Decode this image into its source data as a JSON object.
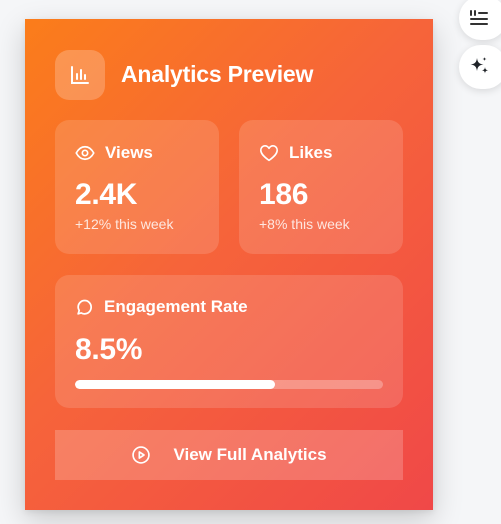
{
  "card": {
    "title": "Analytics Preview",
    "header_icon": "bar-chart-icon",
    "gradient_colors": [
      "#fb7d1a",
      "#f6643a",
      "#f04848"
    ]
  },
  "stats": {
    "views": {
      "icon": "eye-icon",
      "label": "Views",
      "value": "2.4K",
      "change": "+12% this week"
    },
    "likes": {
      "icon": "heart-icon",
      "label": "Likes",
      "value": "186",
      "change": "+8% this week"
    }
  },
  "engagement": {
    "icon": "message-circle-icon",
    "label": "Engagement Rate",
    "value": "8.5%",
    "progress_fraction": 0.65
  },
  "cta": {
    "icon": "play-circle-icon",
    "label": "View Full Analytics"
  },
  "side_buttons": [
    {
      "icon": "quote-lines-icon"
    },
    {
      "icon": "sparkles-icon"
    }
  ]
}
